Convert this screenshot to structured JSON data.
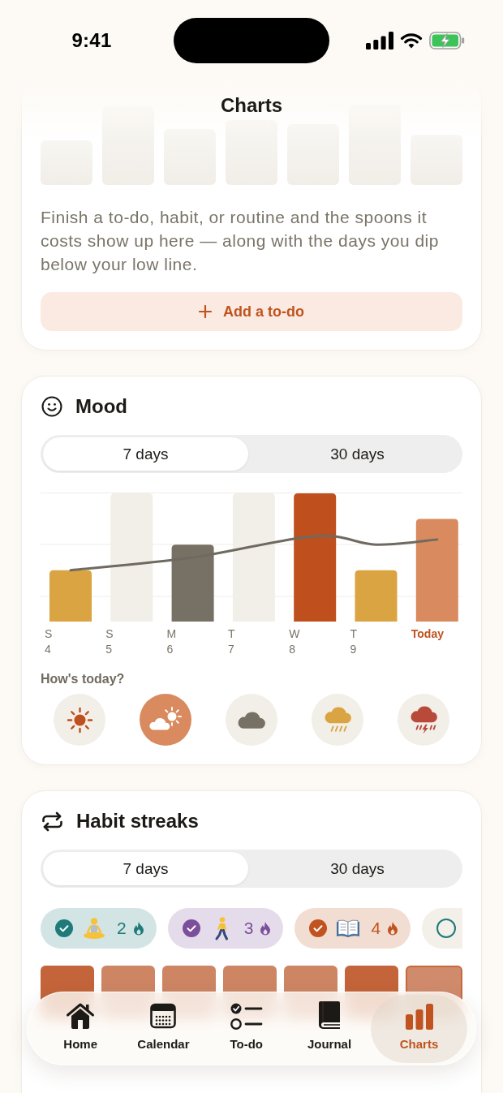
{
  "status_bar": {
    "time": "9:41"
  },
  "header": {
    "title": "Charts"
  },
  "spoons_card": {
    "empty_message": "Finish a to-do, habit, or routine and the spoons it costs show up here — along with the days you dip below your low line.",
    "add_button": {
      "label": "Add a to-do"
    }
  },
  "mood_card": {
    "title": "Mood",
    "range_tabs": [
      {
        "label": "7 days",
        "selected": true
      },
      {
        "label": "30 days",
        "selected": false
      }
    ],
    "days": [
      {
        "label": "S",
        "date": "4",
        "kind": "rain",
        "today": false
      },
      {
        "label": "S",
        "date": "5",
        "kind": "none",
        "today": false
      },
      {
        "label": "M",
        "date": "6",
        "kind": "cloudy",
        "today": false
      },
      {
        "label": "T",
        "date": "7",
        "kind": "none",
        "today": false
      },
      {
        "label": "W",
        "date": "8",
        "kind": "sunny",
        "today": false
      },
      {
        "label": "T",
        "date": "9",
        "kind": "rain",
        "today": false
      },
      {
        "label": "Today",
        "kind": "partly_sunny",
        "today": true
      }
    ],
    "prompt": "How's today?",
    "options": [
      {
        "kind": "sunny",
        "selected": false
      },
      {
        "kind": "partly_sunny",
        "selected": true
      },
      {
        "kind": "cloudy",
        "selected": false
      },
      {
        "kind": "rain",
        "selected": false
      },
      {
        "kind": "storm",
        "selected": false
      }
    ]
  },
  "habit_card": {
    "title": "Habit streaks",
    "range_tabs": [
      {
        "label": "7 days",
        "selected": true
      },
      {
        "label": "30 days",
        "selected": false
      }
    ],
    "chips": [
      {
        "checked": true,
        "count": "2",
        "color": "#1f7a7a"
      },
      {
        "checked": true,
        "count": "3",
        "color": "#7b4f9a"
      },
      {
        "checked": true,
        "count": "4",
        "color": "#c0531f"
      },
      {
        "checked": false,
        "color": "#1f7a7a"
      }
    ],
    "cells": [
      {
        "color": "#c4643a",
        "today": false
      },
      {
        "color": "#cd8563",
        "today": false
      },
      {
        "color": "#cd8563",
        "today": false
      },
      {
        "color": "#cd8563",
        "today": false
      },
      {
        "color": "#cd8563",
        "today": false
      },
      {
        "color": "#c4643a",
        "today": false
      },
      {
        "color": "#d08b6c",
        "today": true
      }
    ]
  },
  "tab_bar": {
    "items": [
      {
        "label": "Home",
        "selected": false
      },
      {
        "label": "Calendar",
        "selected": false
      },
      {
        "label": "To-do",
        "selected": false
      },
      {
        "label": "Journal",
        "selected": false
      },
      {
        "label": "Charts",
        "selected": true
      }
    ]
  }
}
